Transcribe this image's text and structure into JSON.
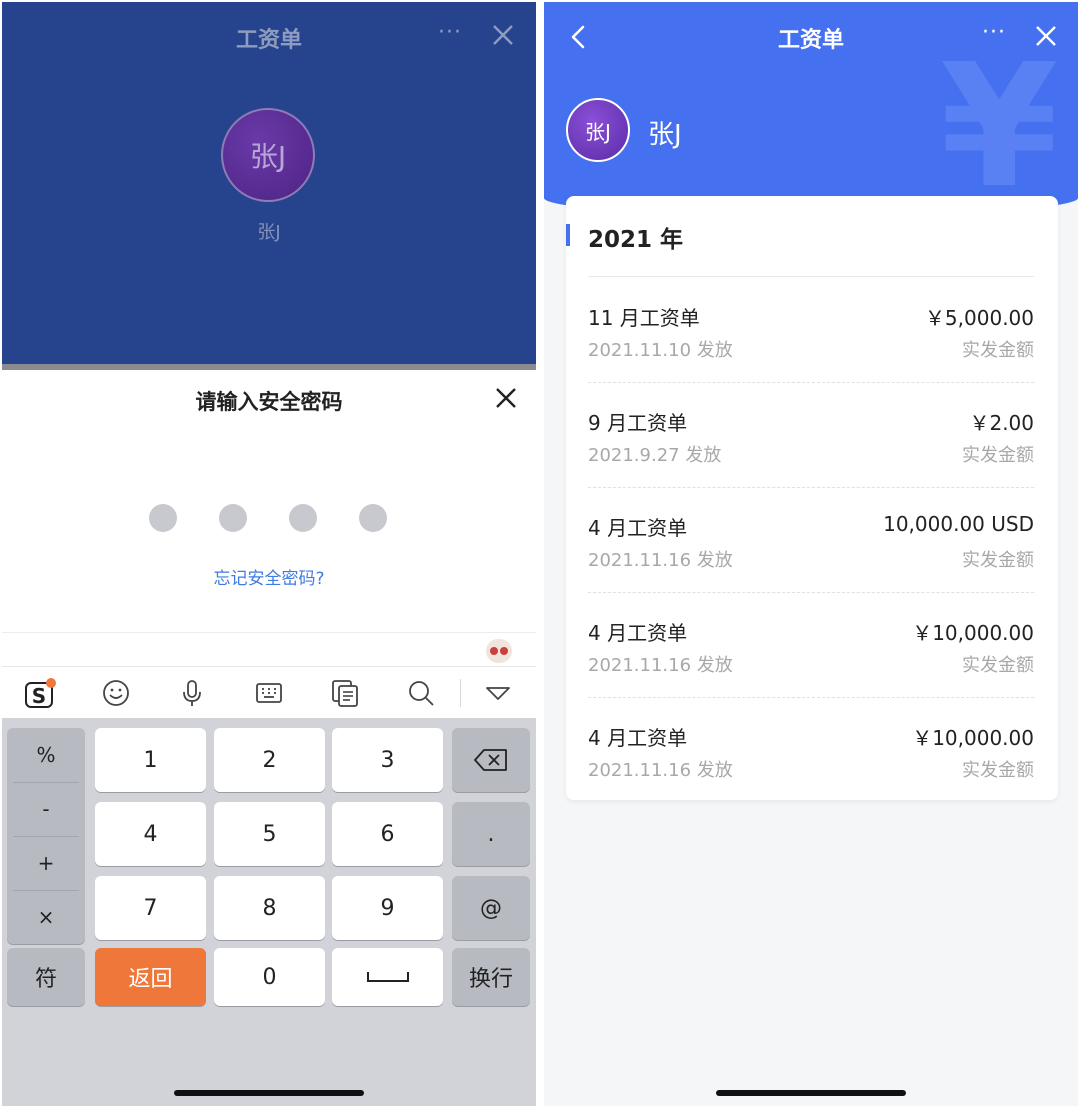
{
  "left": {
    "header": {
      "title": "工资单",
      "more": "···",
      "avatar_text": "张J",
      "name": "张J"
    },
    "password_sheet": {
      "title": "请输入安全密码",
      "forgot_link": "忘记安全密码?"
    },
    "keyboard": {
      "toolbar_icons": [
        "sogou-logo-icon",
        "emoji-icon",
        "microphone-icon",
        "keyboard-icon",
        "clipboard-icon",
        "search-icon",
        "hide-keyboard-icon"
      ],
      "symbols": [
        "%",
        "-",
        "+",
        "×"
      ],
      "digits": [
        "1",
        "2",
        "3",
        "4",
        "5",
        "6",
        "7",
        "8",
        "9"
      ],
      "dot": ".",
      "at": "@",
      "symbol_key": "符",
      "return_key": "返回",
      "zero": "0",
      "enter_key": "换行"
    }
  },
  "right": {
    "header": {
      "title": "工资单",
      "more": "···",
      "avatar_text": "张J",
      "name": "张J",
      "watermark": "¥"
    },
    "year": "2021 年",
    "payslips": [
      {
        "title": "11 月工资单",
        "date": "2021.11.10 发放",
        "amount": "￥5,000.00",
        "label": "实发金额"
      },
      {
        "title": "9 月工资单",
        "date": "2021.9.27 发放",
        "amount": "￥2.00",
        "label": "实发金额"
      },
      {
        "title": "4 月工资单",
        "date": "2021.11.16 发放",
        "amount": "10,000.00 USD",
        "label": "实发金额"
      },
      {
        "title": "4 月工资单",
        "date": "2021.11.16 发放",
        "amount": "￥10,000.00",
        "label": "实发金额"
      },
      {
        "title": "4 月工资单",
        "date": "2021.11.16 发放",
        "amount": "￥10,000.00",
        "label": "实发金额"
      }
    ]
  },
  "colors": {
    "left_header": "#26438e",
    "right_header": "#4570f0",
    "accent_orange": "#f0773a",
    "link_blue": "#3f7be3"
  }
}
